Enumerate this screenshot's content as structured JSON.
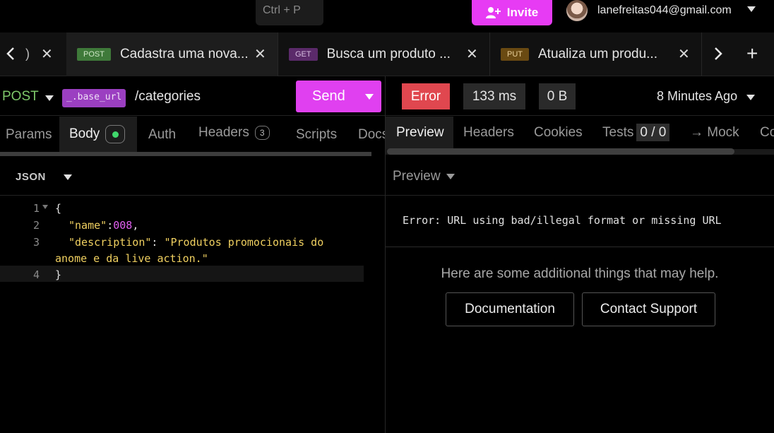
{
  "topbar": {
    "shortcut": "Ctrl + P",
    "invite_label": "Invite",
    "user_email": "lanefreitas044@gmail.com"
  },
  "tabs": {
    "first_partial": ")",
    "items": [
      {
        "method": "POST",
        "title": "Cadastra uma nova...",
        "active": true
      },
      {
        "method": "GET",
        "title": "Busca um produto ...",
        "active": false
      },
      {
        "method": "PUT",
        "title": "Atualiza um produ...",
        "active": false
      }
    ],
    "close_glyph": "✕",
    "add_glyph": "+"
  },
  "request": {
    "method": "POST",
    "env_var": "_.base_url",
    "path": "/categories",
    "send_label": "Send",
    "subtabs": [
      "Params",
      "Body",
      "Auth",
      "Headers",
      "Scripts",
      "Docs"
    ],
    "headers_count": "3",
    "active_subtab": "Body",
    "body_format": "JSON",
    "line_numbers": [
      "1",
      "2",
      "3",
      "4"
    ],
    "body": {
      "open_brace": "{",
      "name_key": "\"name\"",
      "name_value": "008",
      "desc_key": "\"description\"",
      "desc_value_line1": "\"Produtos promocionais do",
      "desc_value_line2": "anome e da live action.\"",
      "close_brace": "}"
    }
  },
  "response": {
    "status": "Error",
    "time": "133 ms",
    "size": "0 B",
    "time_ago": "8 Minutes Ago",
    "tabs": [
      "Preview",
      "Headers",
      "Cookies",
      "Tests",
      "→ Mock",
      "Co"
    ],
    "tests_count": "0 / 0",
    "preview_mode": "Preview",
    "error_message": "Error: URL using bad/illegal format or missing URL",
    "help_text": "Here are some additional things that may help.",
    "doc_button": "Documentation",
    "support_button": "Contact Support"
  },
  "colors": {
    "accent": "#e040f0",
    "error": "#e0474f",
    "post": "#7ec86a",
    "json_key": "#f0d060",
    "json_number": "#e060f0"
  }
}
